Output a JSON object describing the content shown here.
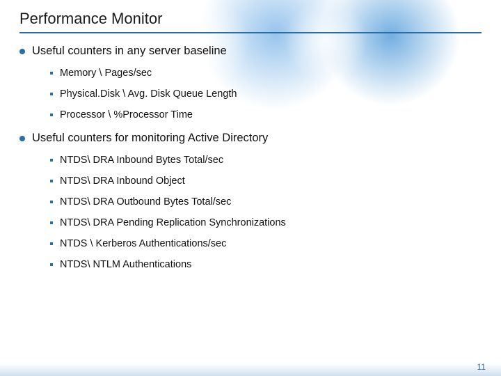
{
  "title": "Performance Monitor",
  "sections": [
    {
      "heading": "Useful counters in any server baseline",
      "items": [
        "Memory \\ Pages/sec",
        "Physical.Disk \\ Avg. Disk Queue Length",
        "Processor \\ %Processor Time"
      ]
    },
    {
      "heading": "Useful counters for monitoring Active Directory",
      "items": [
        "NTDS\\ DRA Inbound Bytes Total/sec",
        "NTDS\\ DRA Inbound Object",
        "NTDS\\ DRA Outbound Bytes Total/sec",
        "NTDS\\ DRA Pending Replication Synchronizations",
        "NTDS \\ Kerberos Authentications/sec",
        "NTDS\\ NTLM Authentications"
      ]
    }
  ],
  "page_number": "11"
}
